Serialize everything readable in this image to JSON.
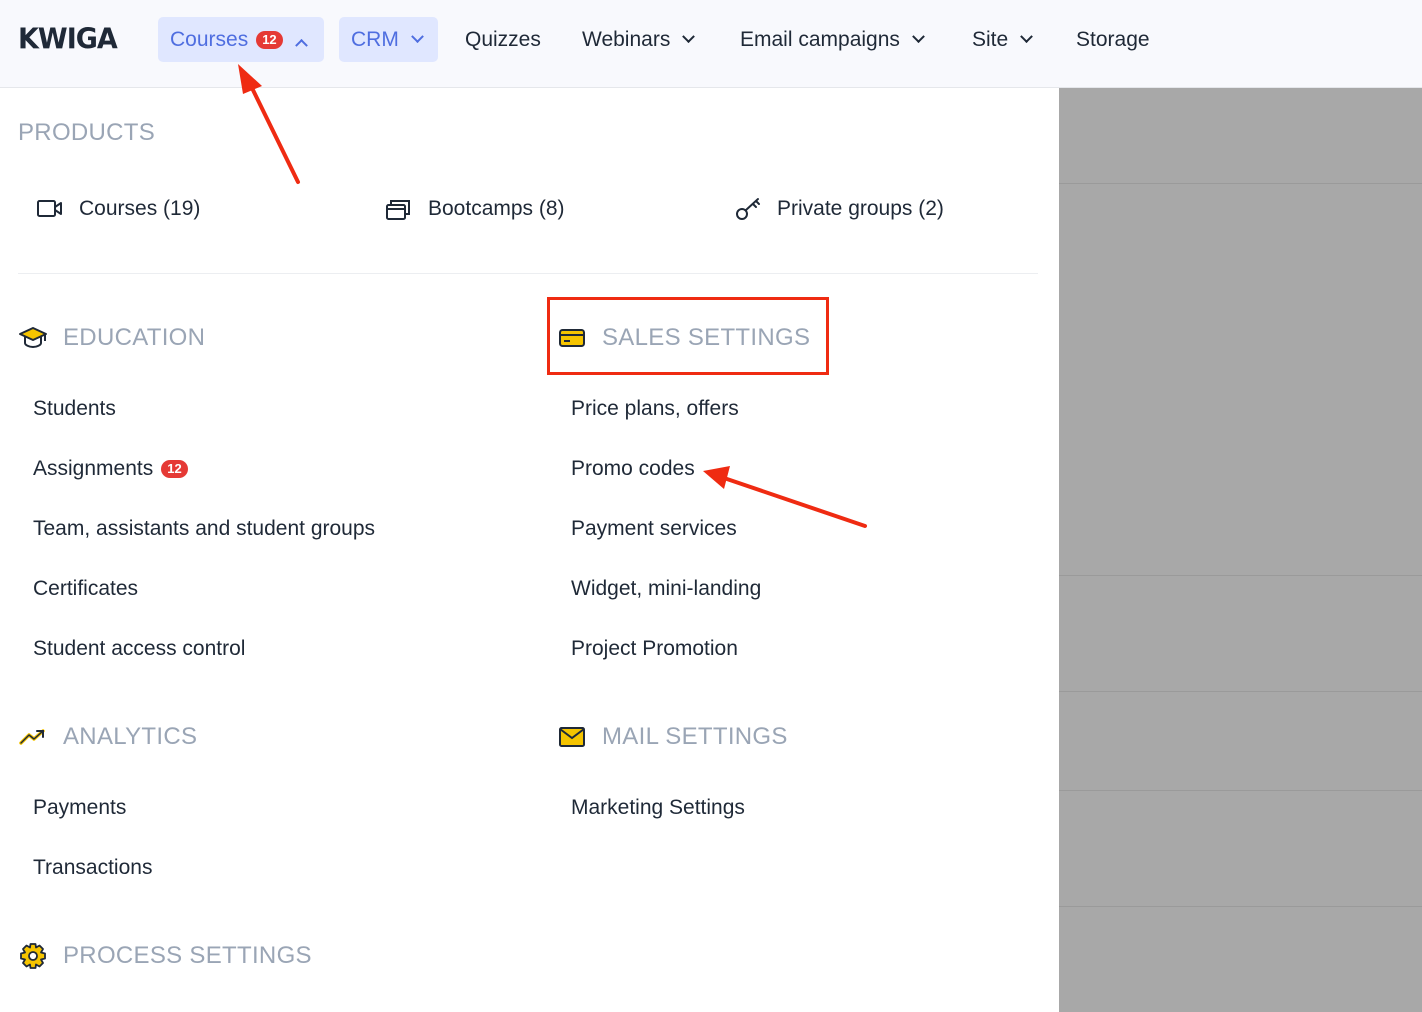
{
  "brand": {
    "logo": "KWIGA"
  },
  "nav": {
    "courses": {
      "label": "Courses",
      "badge": "12"
    },
    "crm": {
      "label": "CRM"
    },
    "quizzes": {
      "label": "Quizzes"
    },
    "webinars": {
      "label": "Webinars"
    },
    "email": {
      "label": "Email campaigns"
    },
    "site": {
      "label": "Site"
    },
    "storage": {
      "label": "Storage"
    }
  },
  "products": {
    "title": "PRODUCTS",
    "items": [
      {
        "label": "Courses (19)",
        "icon": "video-camera-icon"
      },
      {
        "label": "Bootcamps (8)",
        "icon": "stacked-windows-icon"
      },
      {
        "label": "Private groups (2)",
        "icon": "key-icon"
      }
    ]
  },
  "education": {
    "title": "EDUCATION",
    "icon": "graduation-cap-icon",
    "items": [
      "Students",
      "Assignments",
      "Team, assistants and student groups",
      "Certificates",
      "Student access control"
    ],
    "assignments_badge": "12"
  },
  "sales": {
    "title": "SALES SETTINGS",
    "icon": "credit-card-icon",
    "items": [
      "Price plans, offers",
      "Promo codes",
      "Payment services",
      "Widget, mini-landing",
      "Project Promotion"
    ]
  },
  "analytics": {
    "title": "ANALYTICS",
    "icon": "trending-up-icon",
    "items": [
      "Payments",
      "Transactions"
    ]
  },
  "mail": {
    "title": "MAIL SETTINGS",
    "icon": "envelope-icon",
    "items": [
      "Marketing Settings"
    ]
  },
  "process": {
    "title": "PROCESS SETTINGS",
    "icon": "gear-icon"
  },
  "colors": {
    "accent": "#4f6ee0",
    "badge": "#e53935",
    "annotation": "#ef2b12",
    "section_icon": "#f5c400"
  }
}
